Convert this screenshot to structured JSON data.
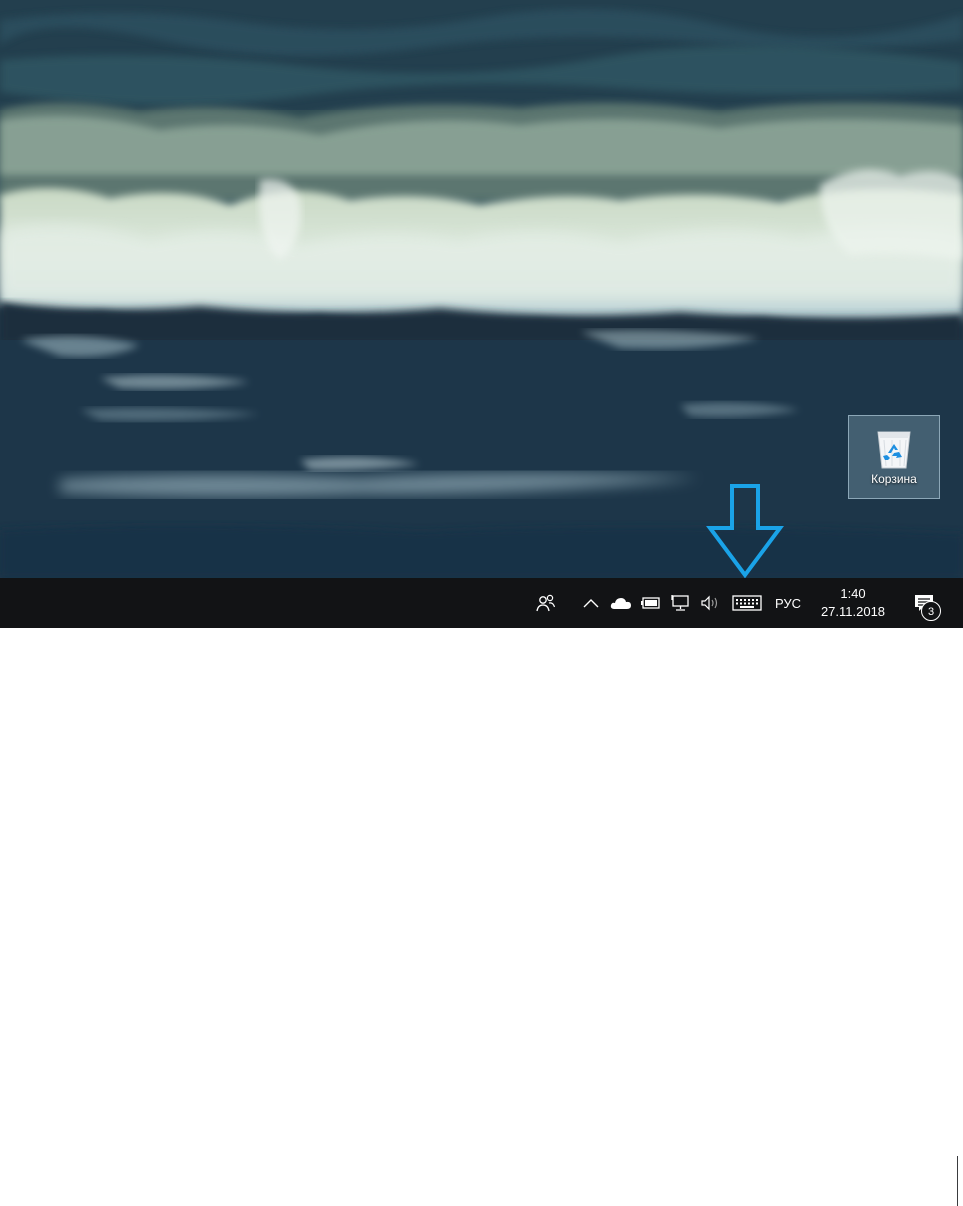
{
  "desktop": {
    "icons": [
      {
        "label": "Корзина",
        "icon": "recycle-bin-icon"
      }
    ]
  },
  "annotation": {
    "icon": "down-arrow-annotation",
    "color": "#1aa3e8"
  },
  "taskbar": {
    "background": "#121315",
    "tray": {
      "people_icon": "people-icon",
      "hidden_icons_icon": "chevron-up-icon",
      "onedrive_icon": "cloud-icon",
      "battery_icon": "battery-icon",
      "network_icon": "network-icon",
      "volume_icon": "speaker-icon",
      "touch_keyboard_icon": "keyboard-icon",
      "language": "РУС",
      "time": "1:40",
      "date": "27.11.2018",
      "action_center_icon": "notification-icon",
      "notification_count": "3"
    }
  }
}
